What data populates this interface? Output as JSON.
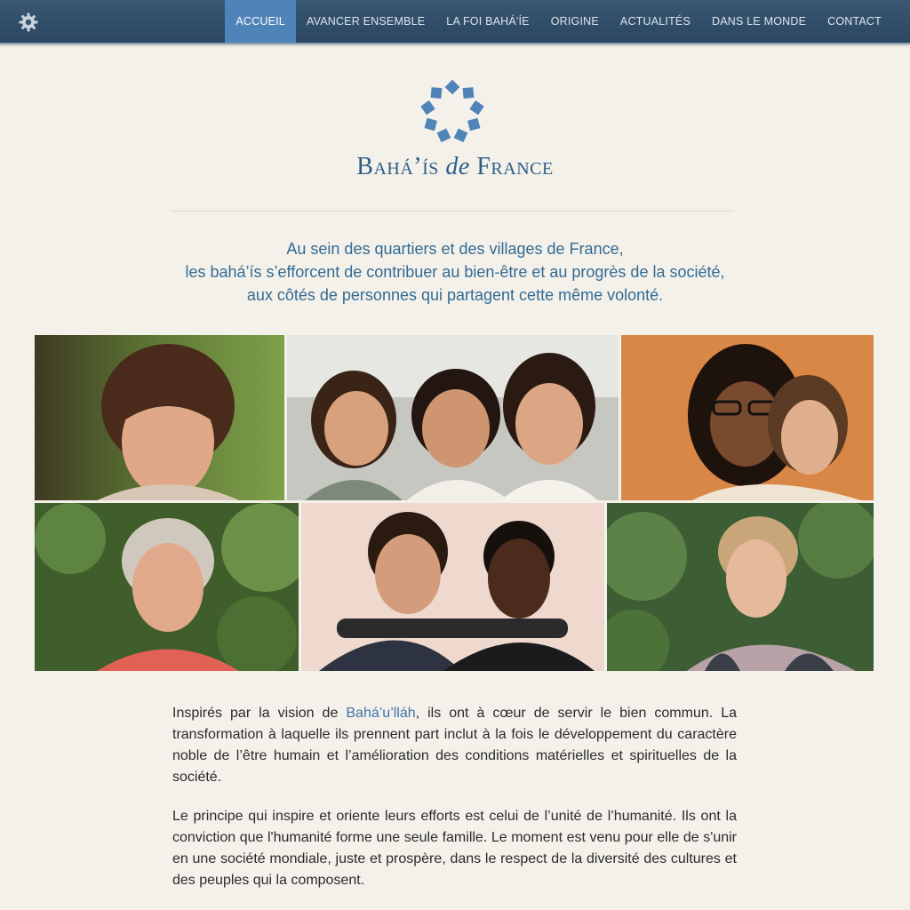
{
  "nav": {
    "items": [
      "ACCUEIL",
      "AVANCER ENSEMBLE",
      "LA FOI BAHÁ'ÍE",
      "ORIGINE",
      "ACTUALITÉS",
      "DANS LE MONDE",
      "CONTACT"
    ],
    "active_index": 0
  },
  "logo": {
    "part1": "Bahá’ís ",
    "part2": "de",
    "part3": " France"
  },
  "tagline": {
    "line1": "Au sein des quartiers et des villages de France,",
    "line2": "les bahá’ís s’efforcent de contribuer au bien-être et au progrès de la société,",
    "line3": "aux côtés de personnes qui partagent cette même volonté."
  },
  "body": {
    "p1_before": "Inspirés par la vision de ",
    "p1_link": "Bahá’u’lláh",
    "p1_after": ", ils ont à cœur de servir le bien commun. La transformation à laquelle ils prennent part inclut à la fois le développement du caractère noble de l’être humain et l’amélioration des conditions matérielles et spirituelles de la société.",
    "p2": "Le principe qui inspire et oriente leurs efforts est celui de l’unité de l’humanité. Ils ont la conviction que l'humanité forme une seule famille. Le moment est venu pour elle de s'unir en une société mondiale, juste et prospère, dans le respect de la diversité des cultures et des peuples qui la composent."
  },
  "colors": {
    "nav_bg": "#2f4d68",
    "nav_active": "#4f84b8",
    "brand_blue": "#2d5d86",
    "link": "#3f74a8",
    "page_bg": "#f4f1ea"
  },
  "icons": {
    "settings": "gear-icon",
    "emblem": "nine-pointed-emblem"
  }
}
